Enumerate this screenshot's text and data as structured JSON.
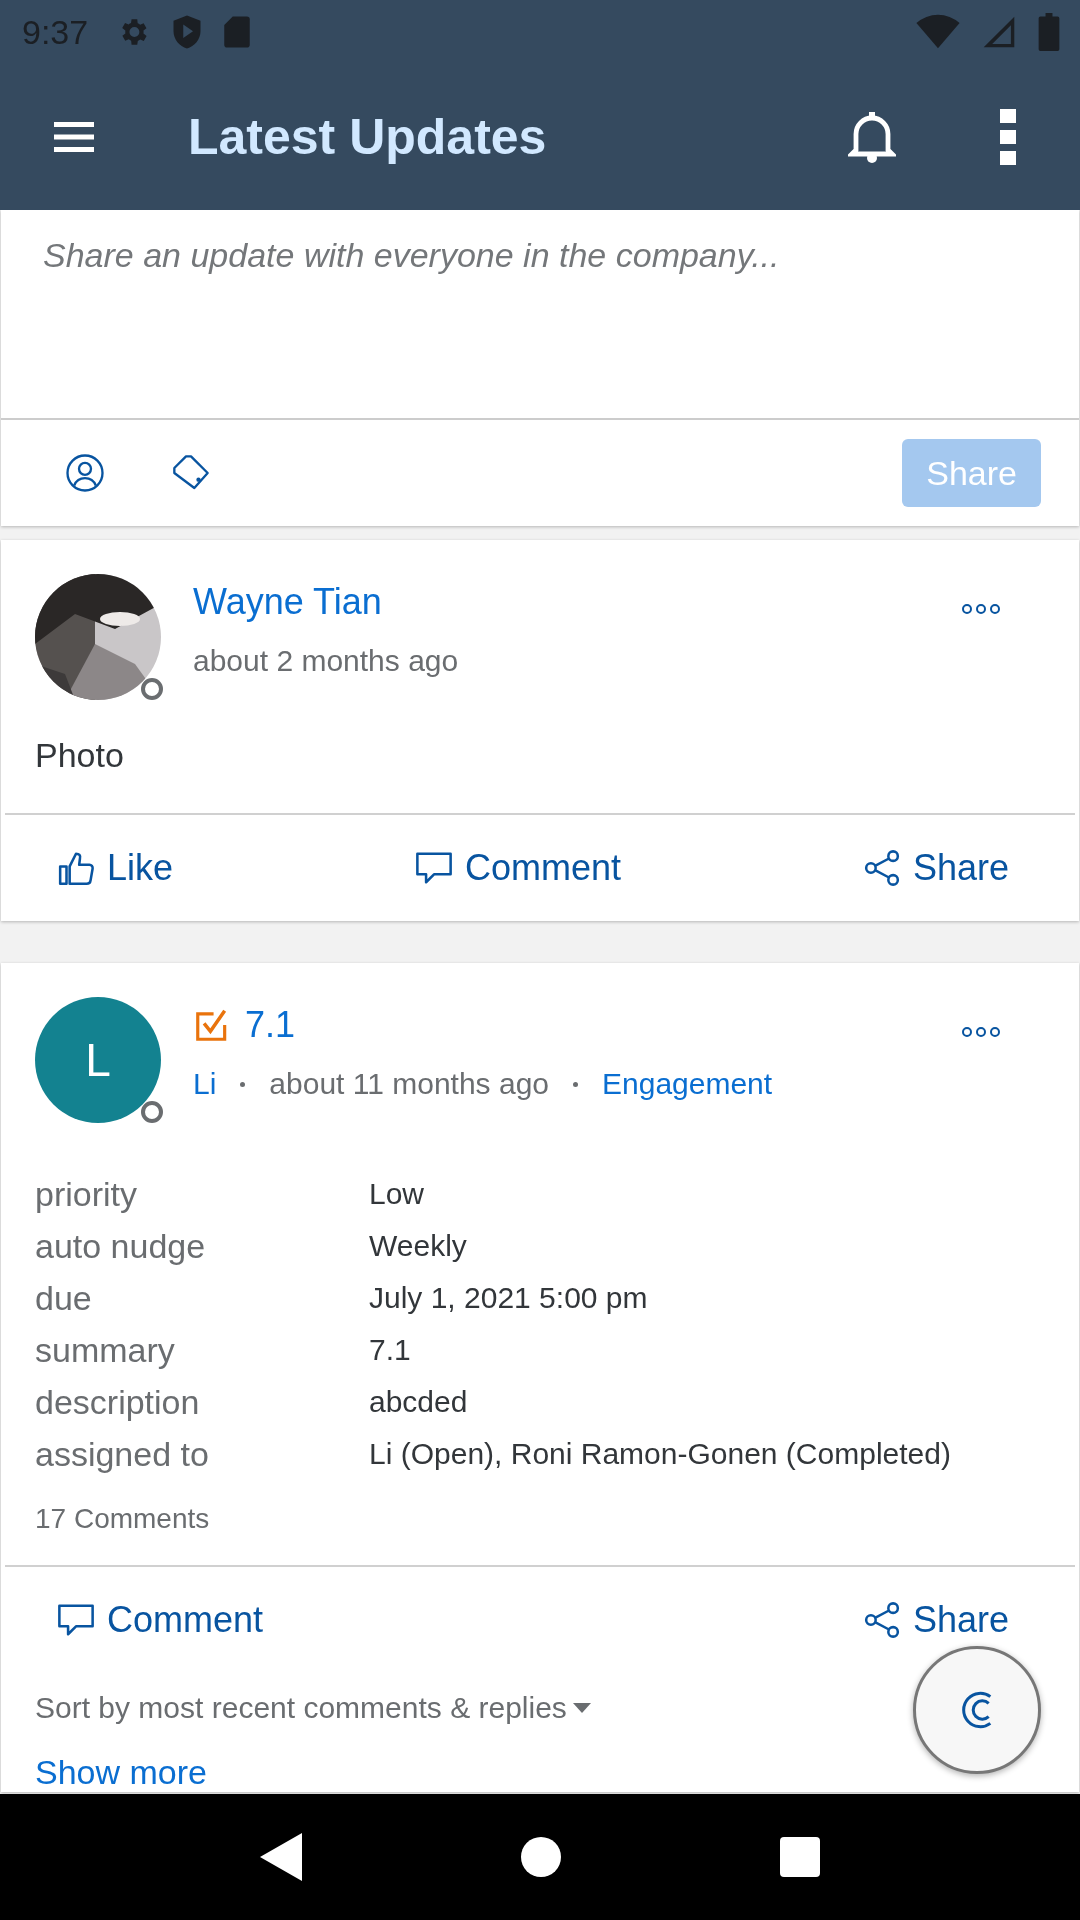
{
  "status_bar": {
    "time": "9:37"
  },
  "app_bar": {
    "title": "Latest Updates"
  },
  "composer": {
    "placeholder": "Share an update with everyone in the company...",
    "share_button": {
      "label": "Share",
      "disabled": true
    }
  },
  "posts": [
    {
      "author": "Wayne Tian",
      "time": "about 2 months ago",
      "body": "Photo",
      "actions": [
        {
          "kind": "like",
          "label": "Like"
        },
        {
          "kind": "comment",
          "label": "Comment"
        },
        {
          "kind": "share",
          "label": "Share"
        }
      ]
    },
    {
      "kind": "task",
      "title": "7.1",
      "avatar": {
        "kind": "initial",
        "text": "L"
      },
      "author": "Li",
      "time": "about 11 months ago",
      "group": "Engagement",
      "fields": [
        {
          "label": "priority",
          "value": "Low"
        },
        {
          "label": "auto nudge",
          "value": "Weekly"
        },
        {
          "label": "due",
          "value": "July 1, 2021 5:00 pm"
        },
        {
          "label": "summary",
          "value": "7.1"
        },
        {
          "label": "description",
          "value": "abcded"
        },
        {
          "label": "assigned to",
          "value": "Li (Open), Roni Ramon-Gonen (Completed)"
        }
      ],
      "comments_count": "17 Comments",
      "actions": [
        {
          "kind": "comment",
          "label": "Comment"
        },
        {
          "kind": "share",
          "label": "Share"
        }
      ],
      "sort": "Sort by most recent comments & replies",
      "show_more": "Show more"
    }
  ]
}
